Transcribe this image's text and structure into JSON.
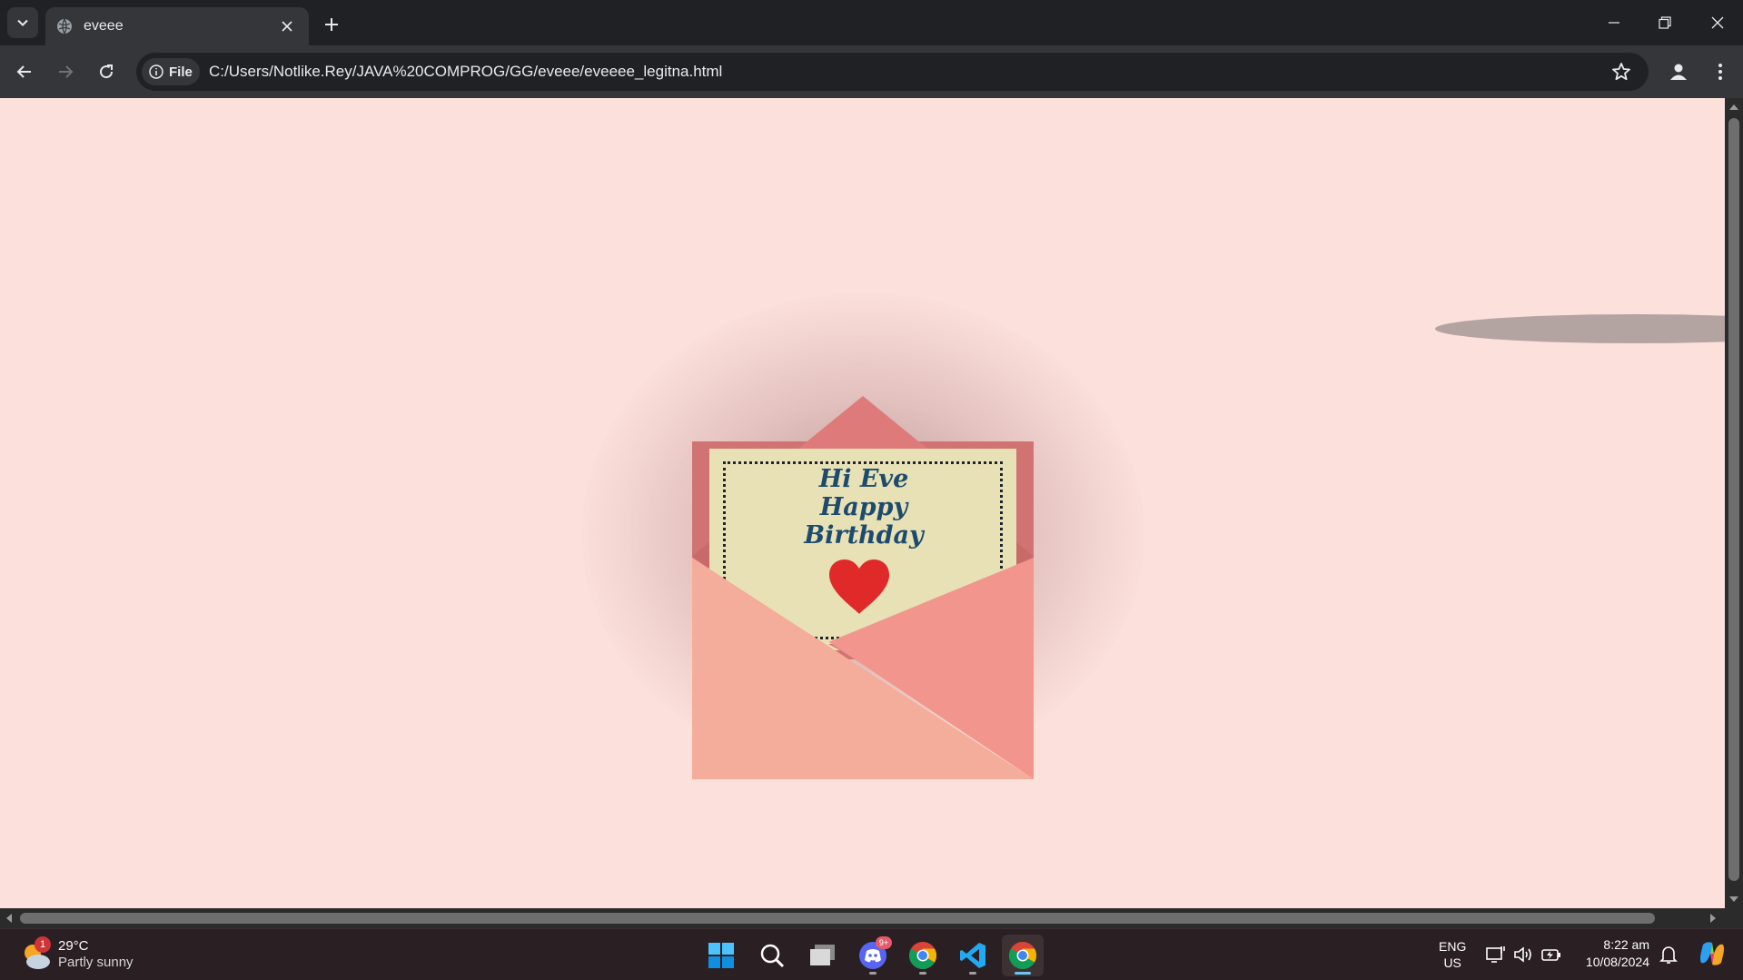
{
  "browser": {
    "tab_title": "eveee",
    "url": "C:/Users/Notlike.Rey/JAVA%20COMPROG/GG/eveee/eveeee_legitna.html",
    "site_info_label": "File"
  },
  "card": {
    "line1": "Hi Eve",
    "line2": "Happy",
    "line3": "Birthday"
  },
  "colors": {
    "page_background": "#fce0dc",
    "envelope_front": "#f5ad9b",
    "envelope_flap": "#de7a7a",
    "card": "#e8e1b6",
    "heart": "#e02a2a",
    "card_text": "#1d4b6e"
  },
  "taskbar": {
    "weather": {
      "temperature": "29°C",
      "condition": "Partly sunny",
      "badge": "1"
    },
    "apps": [
      {
        "name": "start",
        "icon": "windows-logo-icon"
      },
      {
        "name": "search",
        "icon": "search-icon"
      },
      {
        "name": "task-view",
        "icon": "task-view-icon"
      },
      {
        "name": "discord",
        "icon": "discord-icon",
        "badge": "9+"
      },
      {
        "name": "chrome",
        "icon": "chrome-icon"
      },
      {
        "name": "vscode",
        "icon": "vscode-icon"
      },
      {
        "name": "chrome-active",
        "icon": "chrome-icon"
      }
    ],
    "language": {
      "line1": "ENG",
      "line2": "US"
    },
    "clock": {
      "time": "8:22 am",
      "date": "10/08/2024"
    }
  }
}
